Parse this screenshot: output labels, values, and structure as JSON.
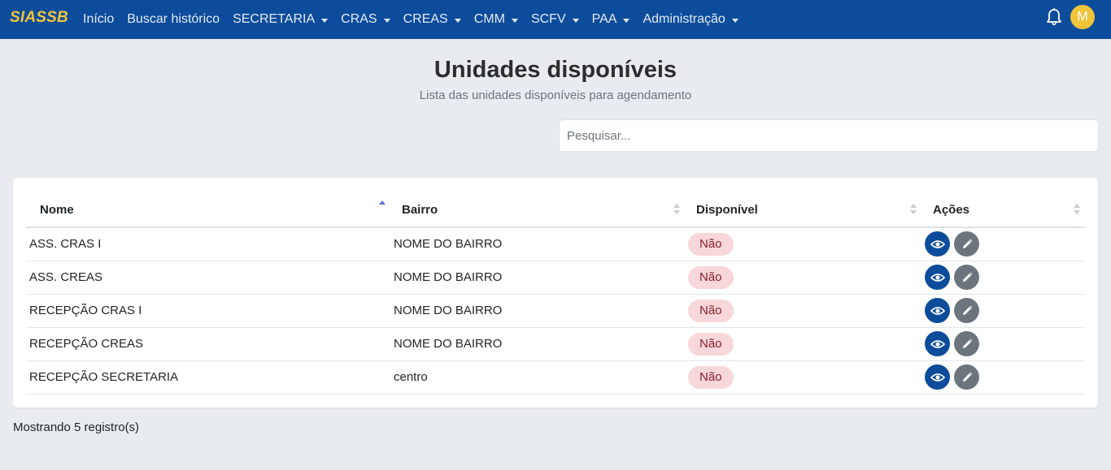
{
  "brand": "SIASSB",
  "nav": {
    "items": [
      {
        "label": "Início",
        "dropdown": false
      },
      {
        "label": "Buscar histórico",
        "dropdown": false
      },
      {
        "label": "SECRETARIA",
        "dropdown": true
      },
      {
        "label": "CRAS",
        "dropdown": true
      },
      {
        "label": "CREAS",
        "dropdown": true
      },
      {
        "label": "CMM",
        "dropdown": true
      },
      {
        "label": "SCFV",
        "dropdown": true
      },
      {
        "label": "PAA",
        "dropdown": true
      },
      {
        "label": "Administração",
        "dropdown": true
      }
    ],
    "avatar_initial": "M",
    "bell_icon": "bell-icon"
  },
  "header": {
    "title": "Unidades disponíveis",
    "subtitle": "Lista das unidades disponíveis para agendamento"
  },
  "search": {
    "placeholder": "Pesquisar...",
    "value": ""
  },
  "table": {
    "columns": [
      "Nome",
      "Bairro",
      "Disponível",
      "Ações"
    ],
    "sorted_column": "Nome",
    "sort_direction": "asc",
    "rows": [
      {
        "nome": "ASS. CRAS I",
        "bairro": "NOME DO BAIRRO",
        "disponivel": "Não"
      },
      {
        "nome": "ASS. CREAS",
        "bairro": "NOME DO BAIRRO",
        "disponivel": "Não"
      },
      {
        "nome": "RECEPÇÃO CRAS I",
        "bairro": "NOME DO BAIRRO",
        "disponivel": "Não"
      },
      {
        "nome": "RECEPÇÃO CREAS",
        "bairro": "NOME DO BAIRRO",
        "disponivel": "Não"
      },
      {
        "nome": "RECEPÇÃO SECRETARIA",
        "bairro": "centro",
        "disponivel": "Não"
      }
    ],
    "action_icons": [
      "eye-icon",
      "pencil-icon"
    ]
  },
  "footer": {
    "records_text": "Mostrando 5 registro(s)"
  },
  "colors": {
    "navbar": "#0d4c9a",
    "brand": "#f0c43a",
    "avatar": "#f0c43a",
    "background": "#e8ebf0",
    "badge_bg": "#f8d7da",
    "badge_text": "#842029",
    "view_button": "#0d4c9a",
    "edit_button": "#6c757d"
  }
}
